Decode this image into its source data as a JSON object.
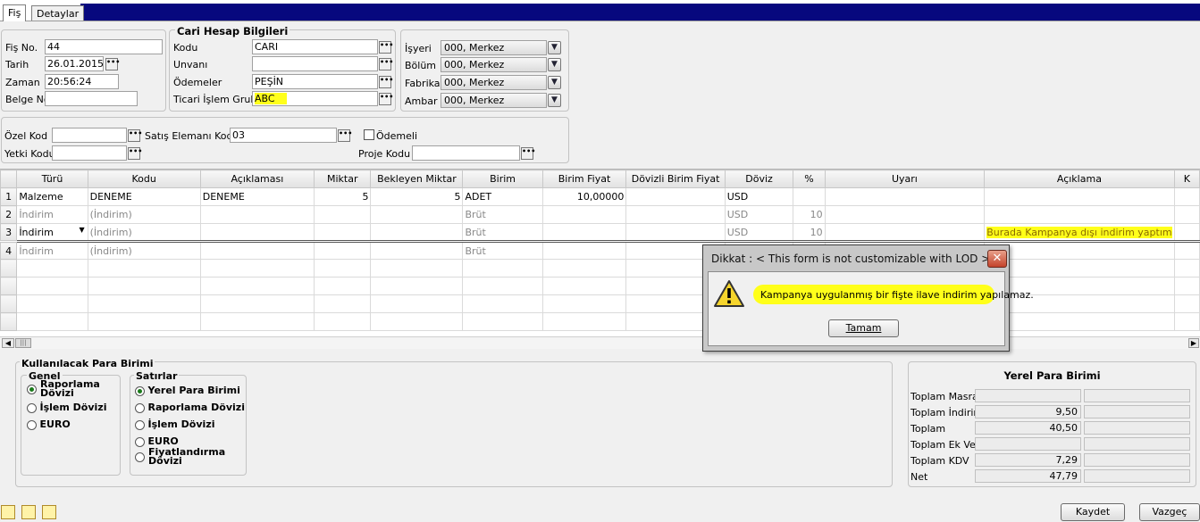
{
  "tabs": [
    {
      "label": "Fiş"
    },
    {
      "label": "Detaylar"
    }
  ],
  "header": {
    "fis_no": {
      "label": "Fiş No.",
      "value": "44"
    },
    "tarih": {
      "label": "Tarih",
      "value": "26.01.2015"
    },
    "zaman": {
      "label": "Zaman",
      "value": "20:56:24"
    },
    "belge_no": {
      "label": "Belge No.",
      "value": ""
    }
  },
  "cari": {
    "title": "Cari Hesap Bilgileri",
    "kodu": {
      "label": "Kodu",
      "value": "CARI"
    },
    "unvani": {
      "label": "Unvanı",
      "value": ""
    },
    "odemeler": {
      "label": "Ödemeler",
      "value": "PEŞİN"
    },
    "ticari": {
      "label": "Ticari İşlem Grubu",
      "value": "ABC"
    }
  },
  "org": {
    "isyeri": {
      "label": "İşyeri",
      "value": "000, Merkez"
    },
    "bolum": {
      "label": "Bölüm",
      "value": "000, Merkez"
    },
    "fabrika": {
      "label": "Fabrika",
      "value": "000, Merkez"
    },
    "ambar": {
      "label": "Ambar",
      "value": "000, Merkez"
    }
  },
  "extra": {
    "ozel_kod": {
      "label": "Özel Kod",
      "value": ""
    },
    "yetki_kodu": {
      "label": "Yetki Kodu",
      "value": ""
    },
    "satis_elemani": {
      "label": "Satış Elemanı Kodu",
      "value": "03"
    },
    "odemeli": {
      "label": "Ödemeli"
    },
    "proje_kodu": {
      "label": "Proje Kodu",
      "value": ""
    }
  },
  "grid": {
    "columns": [
      "Türü",
      "Kodu",
      "Açıklaması",
      "Miktar",
      "Bekleyen Miktar",
      "Birim",
      "Birim Fiyat",
      "Dövizli Birim Fiyat",
      "Döviz",
      "%",
      "Uyarı",
      "Açıklama",
      "K"
    ],
    "rows": [
      {
        "n": "1",
        "turu": "Malzeme",
        "kodu": "DENEME",
        "aciklamasi": "DENEME",
        "miktar": "5",
        "bekleyen": "5",
        "birim": "ADET",
        "birim_fiyat": "10,00000",
        "dovizli": "",
        "doviz": "USD",
        "yuzde": "",
        "uyari": "",
        "aciklama": ""
      },
      {
        "n": "2",
        "turu": "İndirim",
        "kodu": "(İndirim)",
        "aciklamasi": "",
        "miktar": "",
        "bekleyen": "",
        "birim": "Brüt",
        "birim_fiyat": "",
        "dovizli": "",
        "doviz": "USD",
        "yuzde": "10",
        "uyari": "",
        "aciklama": ""
      },
      {
        "n": "3",
        "turu": "İndirim",
        "kodu": "(İndirim)",
        "aciklamasi": "",
        "miktar": "",
        "bekleyen": "",
        "birim": "Brüt",
        "birim_fiyat": "",
        "dovizli": "",
        "doviz": "USD",
        "yuzde": "10",
        "uyari": "",
        "aciklama": "Burada Kampanya dışı indirim yaptım"
      },
      {
        "n": "4",
        "turu": "İndirim",
        "kodu": "(İndirim)",
        "aciklamasi": "",
        "miktar": "",
        "bekleyen": "",
        "birim": "Brüt",
        "birim_fiyat": "",
        "dovizli": "",
        "doviz": "",
        "yuzde": "",
        "uyari": "",
        "aciklama": ""
      }
    ]
  },
  "currency": {
    "title": "Kullanılacak Para Birimi",
    "genel": {
      "title": "Genel",
      "options": [
        "Raporlama Dövizi",
        "İşlem Dövizi",
        "EURO"
      ],
      "selected": 0
    },
    "satirlar": {
      "title": "Satırlar",
      "options": [
        "Yerel Para Birimi",
        "Raporlama Dövizi",
        "İşlem Dövizi",
        "EURO",
        "Fiyatlandırma Dövizi"
      ],
      "selected": 0
    }
  },
  "totals": {
    "title": "Yerel Para Birimi",
    "rows": [
      {
        "label": "Toplam Masraf",
        "value": ""
      },
      {
        "label": "Toplam İndirim",
        "value": "9,50"
      },
      {
        "label": "Toplam",
        "value": "40,50"
      },
      {
        "label": "Toplam Ek Vergi",
        "value": ""
      },
      {
        "label": "Toplam KDV",
        "value": "7,29"
      },
      {
        "label": "Net",
        "value": "47,79"
      }
    ]
  },
  "dialog": {
    "title": "Dikkat : < This form is not customizable with LOD >",
    "message": "Kampanya uygulanmış bir fişte ilave indirim yapılamaz.",
    "ok_label": "Tamam",
    "icon": "warning-icon"
  },
  "footer": {
    "save_label": "Kaydet",
    "cancel_label": "Vazgeç"
  },
  "colors": {
    "title_bar": "#07087e",
    "highlight": "#ffff1a"
  }
}
